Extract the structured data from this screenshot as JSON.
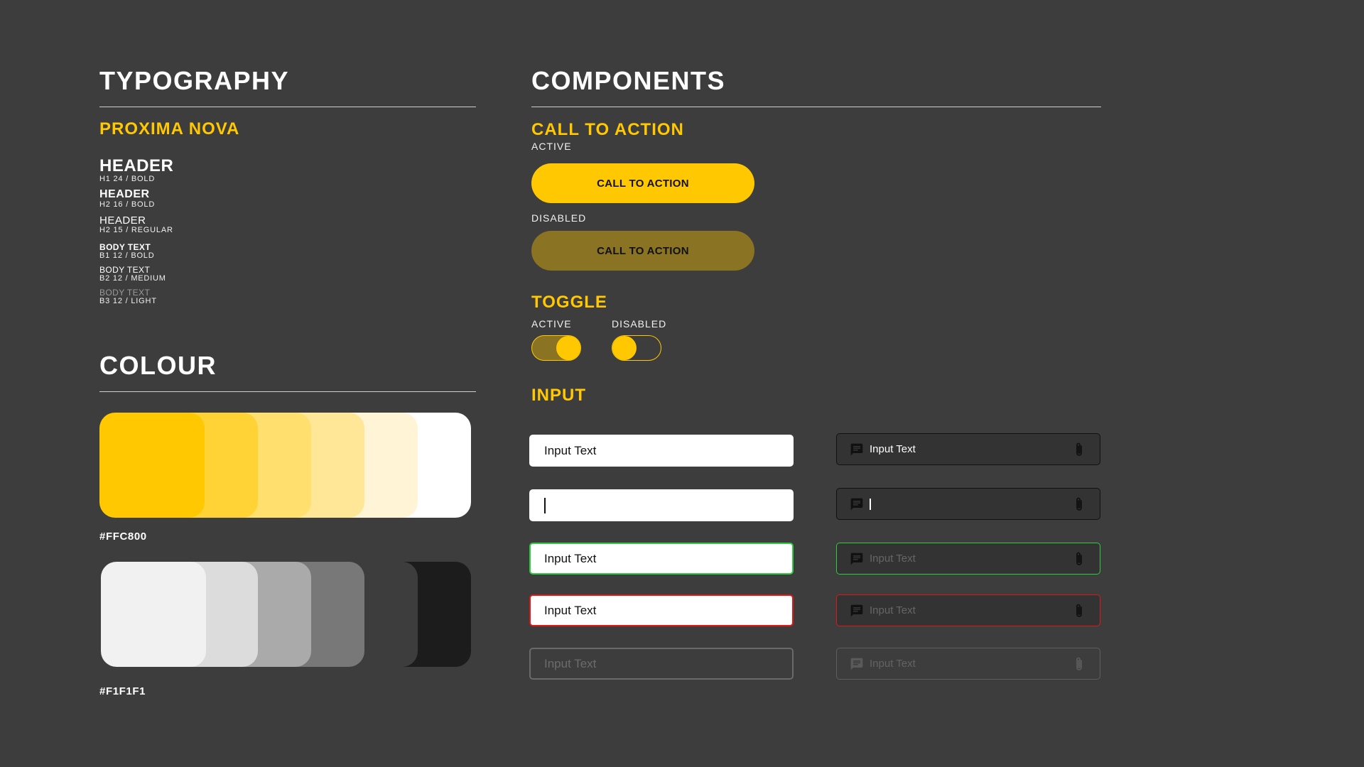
{
  "typography": {
    "title": "TYPOGRAPHY",
    "font_name": "PROXIMA NOVA",
    "samples": [
      {
        "name": "HEADER",
        "spec": "H1 24 / BOLD"
      },
      {
        "name": "HEADER",
        "spec": "H2 16 / BOLD"
      },
      {
        "name": "HEADER",
        "spec": "H2 15 / REGULAR"
      },
      {
        "name": "BODY TEXT",
        "spec": "B1 12 / BOLD"
      },
      {
        "name": "BODY TEXT",
        "spec": "B2 12 / MEDIUM"
      },
      {
        "name": "BODY TEXT",
        "spec": "B3 12 / LIGHT"
      }
    ]
  },
  "colour": {
    "title": "COLOUR",
    "primary_hex": "#FFC800",
    "primary_swatches": [
      "#FFC800",
      "#FFD335",
      "#FFDF6D",
      "#FFE797",
      "#FFF4D6",
      "#FFFFFF"
    ],
    "neutral_hex": "#F1F1F1",
    "neutral_swatches": [
      "#F1F1F1",
      "#DCDCDC",
      "#AAAAAA",
      "#787878",
      "#3D3D3D",
      "#1C1C1C"
    ]
  },
  "components": {
    "title": "COMPONENTS",
    "cta": {
      "title": "CALL TO ACTION",
      "active_label": "ACTIVE",
      "disabled_label": "DISABLED",
      "button_label": "CALL TO ACTION"
    },
    "toggle": {
      "title": "TOGGLE",
      "active_label": "ACTIVE",
      "disabled_label": "DISABLED"
    },
    "input": {
      "title": "INPUT",
      "text": "Input Text"
    }
  },
  "icons": {
    "message": "message-icon",
    "attach": "paperclip-icon"
  }
}
